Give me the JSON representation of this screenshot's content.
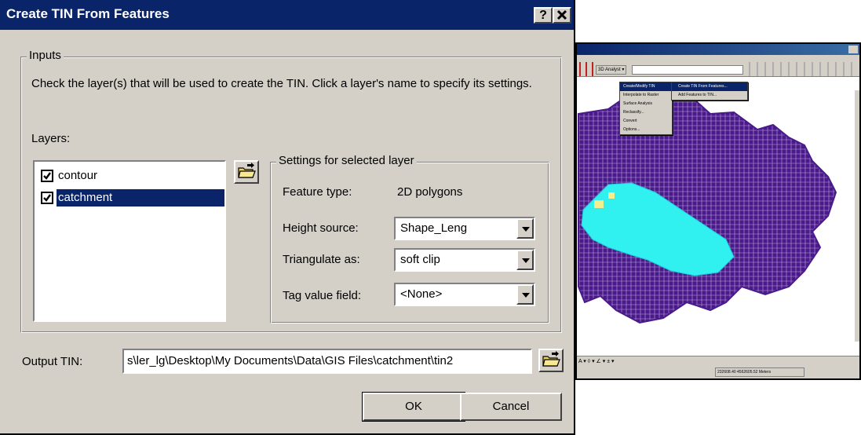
{
  "dialog": {
    "title": "Create TIN From Features",
    "help_button": "?",
    "close_button": "✕"
  },
  "inputs": {
    "group_label": "Inputs",
    "instructions": "Check the layer(s) that will be used to create the TIN.  Click a layer's name to specify its settings.",
    "layers_label": "Layers:",
    "layers": [
      {
        "name": "contour",
        "checked": true,
        "selected": false
      },
      {
        "name": "catchment",
        "checked": true,
        "selected": true
      }
    ]
  },
  "settings": {
    "group_label": "Settings for selected layer",
    "feature_type_label": "Feature type:",
    "feature_type_value": "2D polygons",
    "height_source_label": "Height source:",
    "height_source_value": "Shape_Leng",
    "triangulate_label": "Triangulate as:",
    "triangulate_value": "soft clip",
    "tag_value_label": "Tag value field:",
    "tag_value_value": "<None>"
  },
  "output": {
    "label": "Output TIN:",
    "value": "s\\ler_lg\\Desktop\\My Documents\\Data\\GIS Files\\catchment\\tin2"
  },
  "buttons": {
    "ok": "OK",
    "cancel": "Cancel"
  },
  "background_app": {
    "toolbar_label": "3D Analyst ▾",
    "menu_items": [
      "Create/Modify TIN",
      "Interpolate to Raster",
      "Surface Analysis",
      "Reclassify...",
      "Convert",
      "Options..."
    ],
    "submenu_items": [
      "Create TIN From Features...",
      "Add Features to TIN..."
    ],
    "draw_label": "A ▾ ◊ ▾ ∠ ▾ ± ▾",
    "coordinates": "232608.40  4562605.52 Meters"
  },
  "colors": {
    "title_bar": "#0a246a",
    "dialog_bg": "#d4d0c8",
    "selection": "#0a246a",
    "map_network": "#4a1a8c",
    "map_catchment": "#30f0f0"
  }
}
